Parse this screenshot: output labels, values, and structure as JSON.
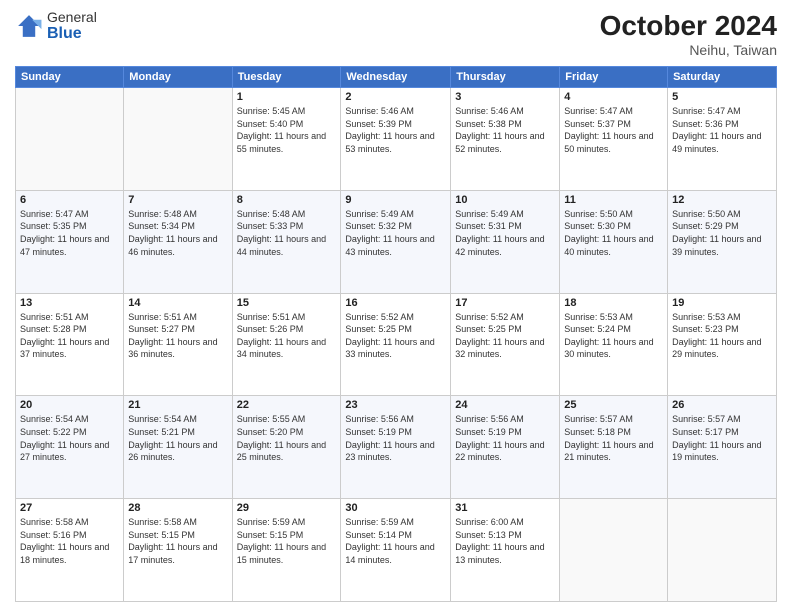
{
  "logo": {
    "general": "General",
    "blue": "Blue"
  },
  "header": {
    "month": "October 2024",
    "location": "Neihu, Taiwan"
  },
  "days_of_week": [
    "Sunday",
    "Monday",
    "Tuesday",
    "Wednesday",
    "Thursday",
    "Friday",
    "Saturday"
  ],
  "weeks": [
    [
      {
        "day": "",
        "info": ""
      },
      {
        "day": "",
        "info": ""
      },
      {
        "day": "1",
        "info": "Sunrise: 5:45 AM\nSunset: 5:40 PM\nDaylight: 11 hours and 55 minutes."
      },
      {
        "day": "2",
        "info": "Sunrise: 5:46 AM\nSunset: 5:39 PM\nDaylight: 11 hours and 53 minutes."
      },
      {
        "day": "3",
        "info": "Sunrise: 5:46 AM\nSunset: 5:38 PM\nDaylight: 11 hours and 52 minutes."
      },
      {
        "day": "4",
        "info": "Sunrise: 5:47 AM\nSunset: 5:37 PM\nDaylight: 11 hours and 50 minutes."
      },
      {
        "day": "5",
        "info": "Sunrise: 5:47 AM\nSunset: 5:36 PM\nDaylight: 11 hours and 49 minutes."
      }
    ],
    [
      {
        "day": "6",
        "info": "Sunrise: 5:47 AM\nSunset: 5:35 PM\nDaylight: 11 hours and 47 minutes."
      },
      {
        "day": "7",
        "info": "Sunrise: 5:48 AM\nSunset: 5:34 PM\nDaylight: 11 hours and 46 minutes."
      },
      {
        "day": "8",
        "info": "Sunrise: 5:48 AM\nSunset: 5:33 PM\nDaylight: 11 hours and 44 minutes."
      },
      {
        "day": "9",
        "info": "Sunrise: 5:49 AM\nSunset: 5:32 PM\nDaylight: 11 hours and 43 minutes."
      },
      {
        "day": "10",
        "info": "Sunrise: 5:49 AM\nSunset: 5:31 PM\nDaylight: 11 hours and 42 minutes."
      },
      {
        "day": "11",
        "info": "Sunrise: 5:50 AM\nSunset: 5:30 PM\nDaylight: 11 hours and 40 minutes."
      },
      {
        "day": "12",
        "info": "Sunrise: 5:50 AM\nSunset: 5:29 PM\nDaylight: 11 hours and 39 minutes."
      }
    ],
    [
      {
        "day": "13",
        "info": "Sunrise: 5:51 AM\nSunset: 5:28 PM\nDaylight: 11 hours and 37 minutes."
      },
      {
        "day": "14",
        "info": "Sunrise: 5:51 AM\nSunset: 5:27 PM\nDaylight: 11 hours and 36 minutes."
      },
      {
        "day": "15",
        "info": "Sunrise: 5:51 AM\nSunset: 5:26 PM\nDaylight: 11 hours and 34 minutes."
      },
      {
        "day": "16",
        "info": "Sunrise: 5:52 AM\nSunset: 5:25 PM\nDaylight: 11 hours and 33 minutes."
      },
      {
        "day": "17",
        "info": "Sunrise: 5:52 AM\nSunset: 5:25 PM\nDaylight: 11 hours and 32 minutes."
      },
      {
        "day": "18",
        "info": "Sunrise: 5:53 AM\nSunset: 5:24 PM\nDaylight: 11 hours and 30 minutes."
      },
      {
        "day": "19",
        "info": "Sunrise: 5:53 AM\nSunset: 5:23 PM\nDaylight: 11 hours and 29 minutes."
      }
    ],
    [
      {
        "day": "20",
        "info": "Sunrise: 5:54 AM\nSunset: 5:22 PM\nDaylight: 11 hours and 27 minutes."
      },
      {
        "day": "21",
        "info": "Sunrise: 5:54 AM\nSunset: 5:21 PM\nDaylight: 11 hours and 26 minutes."
      },
      {
        "day": "22",
        "info": "Sunrise: 5:55 AM\nSunset: 5:20 PM\nDaylight: 11 hours and 25 minutes."
      },
      {
        "day": "23",
        "info": "Sunrise: 5:56 AM\nSunset: 5:19 PM\nDaylight: 11 hours and 23 minutes."
      },
      {
        "day": "24",
        "info": "Sunrise: 5:56 AM\nSunset: 5:19 PM\nDaylight: 11 hours and 22 minutes."
      },
      {
        "day": "25",
        "info": "Sunrise: 5:57 AM\nSunset: 5:18 PM\nDaylight: 11 hours and 21 minutes."
      },
      {
        "day": "26",
        "info": "Sunrise: 5:57 AM\nSunset: 5:17 PM\nDaylight: 11 hours and 19 minutes."
      }
    ],
    [
      {
        "day": "27",
        "info": "Sunrise: 5:58 AM\nSunset: 5:16 PM\nDaylight: 11 hours and 18 minutes."
      },
      {
        "day": "28",
        "info": "Sunrise: 5:58 AM\nSunset: 5:15 PM\nDaylight: 11 hours and 17 minutes."
      },
      {
        "day": "29",
        "info": "Sunrise: 5:59 AM\nSunset: 5:15 PM\nDaylight: 11 hours and 15 minutes."
      },
      {
        "day": "30",
        "info": "Sunrise: 5:59 AM\nSunset: 5:14 PM\nDaylight: 11 hours and 14 minutes."
      },
      {
        "day": "31",
        "info": "Sunrise: 6:00 AM\nSunset: 5:13 PM\nDaylight: 11 hours and 13 minutes."
      },
      {
        "day": "",
        "info": ""
      },
      {
        "day": "",
        "info": ""
      }
    ]
  ]
}
